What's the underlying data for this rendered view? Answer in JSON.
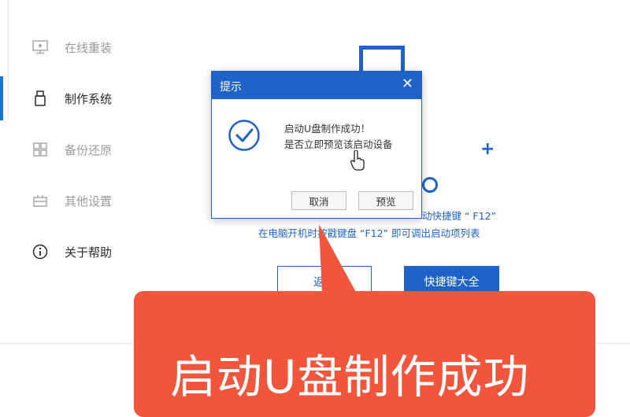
{
  "sidebar": {
    "items": [
      {
        "label": "在线重装",
        "icon": "monitor-icon"
      },
      {
        "label": "制作系统",
        "icon": "usb-icon",
        "active": true
      },
      {
        "label": "备份还原",
        "icon": "grid-icon"
      },
      {
        "label": "其他设置",
        "icon": "box-icon"
      },
      {
        "label": "关于帮助",
        "icon": "info-icon"
      }
    ]
  },
  "main": {
    "tip_line1": "动快捷键 “ F12”",
    "tip_line2": "在电脑开机时按戳键盘 “F12” 即可调出启动项列表",
    "back_label": "返回",
    "shortcut_label": "快捷键大全"
  },
  "dialog": {
    "title": "提示",
    "close": "✕",
    "message_line1": "启动U盘制作成功！",
    "message_line2": "是否立即预览该启动设备",
    "cancel_label": "取消",
    "preview_label": "预览"
  },
  "callout": {
    "text": "启动U盘制作成功"
  },
  "colors": {
    "accent": "#1f62c8",
    "callout": "#f1553c"
  }
}
